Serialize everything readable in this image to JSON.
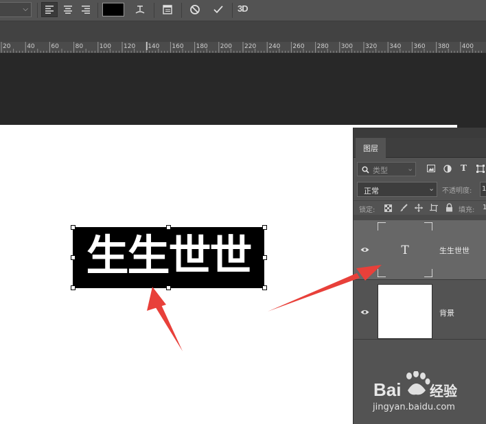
{
  "options_bar": {
    "font_dropdown": {
      "value": "",
      "chevron_icon": "chevron-down-icon"
    },
    "align_buttons": [
      {
        "icon": "align-left-icon",
        "active": true
      },
      {
        "icon": "align-center-icon",
        "active": false
      },
      {
        "icon": "align-right-icon",
        "active": false
      }
    ],
    "text_color": "#000000",
    "warp_icon": "warp-text-icon",
    "panel_icon": "character-panel-icon",
    "cancel_icon": "cancel-icon",
    "commit_icon": "commit-check-icon",
    "threed_label": "3D"
  },
  "ruler": {
    "labels": [
      "20",
      "40",
      "60",
      "80",
      "100",
      "120",
      "140",
      "160",
      "180",
      "200",
      "220",
      "240",
      "260",
      "280",
      "300",
      "320",
      "340",
      "360",
      "380",
      "400"
    ]
  },
  "canvas": {
    "text_layer_content": "生生世世",
    "background_color": "#ffffff",
    "text_box_color": "#000000",
    "text_color": "#ffffff"
  },
  "layers_panel": {
    "tab_label": "图层",
    "filter": {
      "placeholder": "类型",
      "icon": "search-icon"
    },
    "filter_icons": [
      "image-filter-icon",
      "adjustment-filter-icon",
      "type-filter-icon",
      "shape-filter-icon"
    ],
    "blend_mode": "正常",
    "opacity_label": "不透明度:",
    "opacity_value": "1",
    "lock_label": "锁定:",
    "lock_icons": [
      "lock-transparent-icon",
      "lock-brush-icon",
      "lock-move-icon",
      "lock-artboard-icon",
      "lock-all-icon"
    ],
    "fill_label": "填充:",
    "fill_value": "1",
    "layers": [
      {
        "name": "生生世世",
        "type": "text",
        "thumb_label": "T",
        "visible": true,
        "selected": true
      },
      {
        "name": "背景",
        "type": "background",
        "visible": true,
        "selected": false
      }
    ]
  },
  "annotations": {
    "arrow_color": "#e8403a"
  },
  "watermark": {
    "logo_text": "Bai经验",
    "url": "jingyan.baidu.com"
  }
}
